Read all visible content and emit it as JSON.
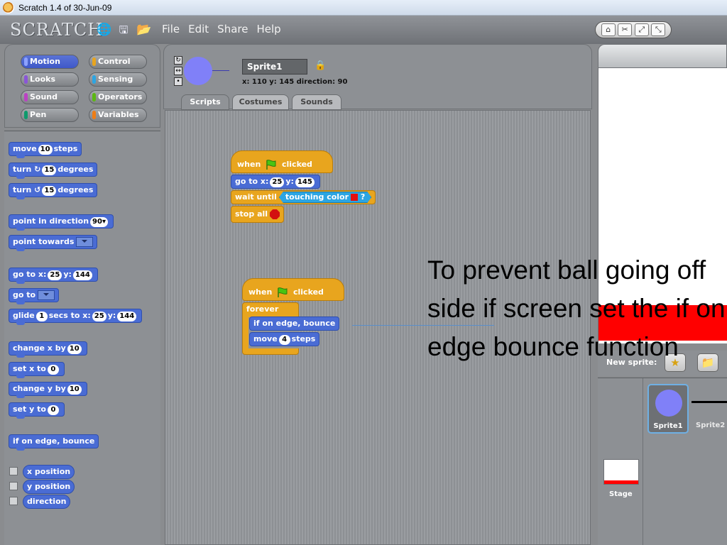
{
  "window": {
    "title": "Scratch 1.4 of 30-Jun-09"
  },
  "menubar": {
    "logo": "SCRATCH",
    "menus": [
      "File",
      "Edit",
      "Share",
      "Help"
    ]
  },
  "categories": [
    {
      "label": "Motion",
      "color": "#4a6cd4",
      "selected": true
    },
    {
      "label": "Control",
      "color": "#e8a51e"
    },
    {
      "label": "Looks",
      "color": "#8a55d7"
    },
    {
      "label": "Sensing",
      "color": "#2ca5e2"
    },
    {
      "label": "Sound",
      "color": "#bb42c3"
    },
    {
      "label": "Operators",
      "color": "#5cb712"
    },
    {
      "label": "Pen",
      "color": "#0e9a6c"
    },
    {
      "label": "Variables",
      "color": "#ee7d16"
    }
  ],
  "palette": {
    "move": {
      "pre": "move",
      "n": "10",
      "post": "steps"
    },
    "turn_cw": {
      "pre": "turn ↻",
      "n": "15",
      "post": "degrees"
    },
    "turn_ccw": {
      "pre": "turn ↺",
      "n": "15",
      "post": "degrees"
    },
    "point_dir": {
      "pre": "point in direction",
      "n": "90▾"
    },
    "point_towards": {
      "pre": "point towards"
    },
    "goto_xy": {
      "pre": "go to x:",
      "x": "25",
      "mid": "y:",
      "y": "144"
    },
    "goto": {
      "pre": "go to"
    },
    "glide": {
      "pre": "glide",
      "n": "1",
      "mid": "secs to x:",
      "x": "25",
      "mid2": "y:",
      "y": "144"
    },
    "change_x": {
      "pre": "change x by",
      "n": "10"
    },
    "set_x": {
      "pre": "set x to",
      "n": "0"
    },
    "change_y": {
      "pre": "change y by",
      "n": "10"
    },
    "set_y": {
      "pre": "set y to",
      "n": "0"
    },
    "bounce": {
      "pre": "if on edge, bounce"
    },
    "x_position": "x position",
    "y_position": "y position",
    "direction": "direction"
  },
  "sprite": {
    "name": "Sprite1",
    "info": "x: 110  y: 145  direction: 90"
  },
  "tabs": [
    "Scripts",
    "Costumes",
    "Sounds"
  ],
  "script1": {
    "hat": {
      "pre": "when",
      "post": "clicked"
    },
    "goto": {
      "pre": "go to x:",
      "x": "25",
      "mid": "y:",
      "y": "145"
    },
    "wait": {
      "pre": "wait until",
      "sensing": "touching color",
      "q": "?"
    },
    "stop": {
      "pre": "stop all"
    }
  },
  "script2": {
    "hat": {
      "pre": "when",
      "post": "clicked"
    },
    "forever": "forever",
    "bounce": "if on edge, bounce",
    "move": {
      "pre": "move",
      "n": "4",
      "post": "steps"
    }
  },
  "stage": {
    "new_sprite_label": "New sprite:",
    "stage_label": "Stage",
    "sprites": [
      "Sprite1",
      "Sprite2"
    ]
  },
  "annotation": {
    "text": "To prevent ball going off side if screen set the if on edge bounce function"
  },
  "colors": {
    "motion": "#4a6cd4",
    "control": "#e8a51e",
    "sensing": "#2ca5e2",
    "stage_red": "#ff0000",
    "sprite_ball": "#8080f8"
  }
}
